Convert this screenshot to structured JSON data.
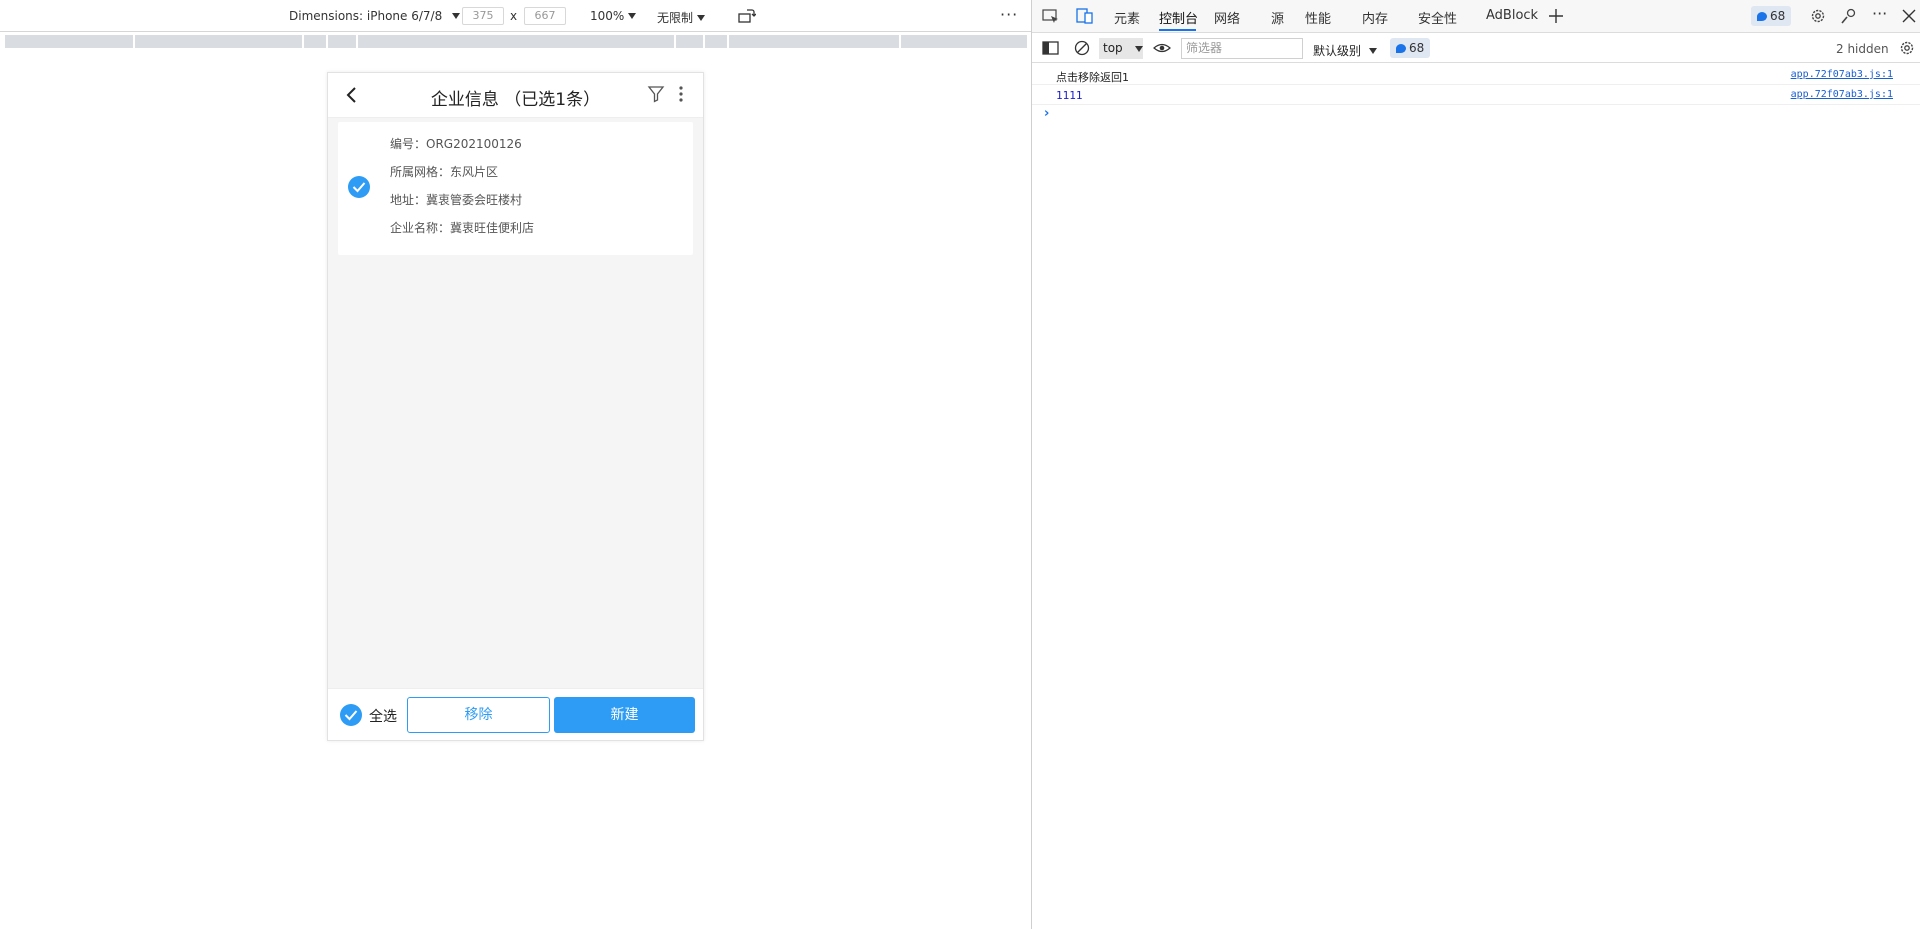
{
  "emulation": {
    "device_label": "Dimensions: iPhone 6/7/8",
    "width_value": "375",
    "height_value": "667",
    "times_sign": "x",
    "zoom_label": "100%",
    "throttle_label": "无限制",
    "more_label": "···"
  },
  "phone": {
    "title": "企业信息 （已选1条）",
    "card": {
      "line1": "编号：ORG202100126",
      "line2": "所属网格：东风片区",
      "line3": "地址：冀衷管委会旺楼村",
      "line4": "企业名称：冀衷旺佳便利店"
    },
    "footer": {
      "select_all_label": "全选",
      "remove_label": "移除",
      "new_label": "新建"
    },
    "accent_color": "#2e9cf5"
  },
  "devtools": {
    "tabs": [
      "元素",
      "控制台",
      "网络",
      "源",
      "性能",
      "内存",
      "安全性",
      "AdBlock"
    ],
    "active_tab": "控制台",
    "issue_count": "68",
    "context_value": "top",
    "filter_placeholder": "筛选器",
    "level_label": "默认级别",
    "hidden_label": "2 hidden",
    "logs": [
      {
        "message": "点击移除返回1",
        "source": "app.72f07ab3.js:1"
      },
      {
        "message": "1111",
        "source": "app.72f07ab3.js:1"
      }
    ],
    "prompt_symbol": "›"
  }
}
